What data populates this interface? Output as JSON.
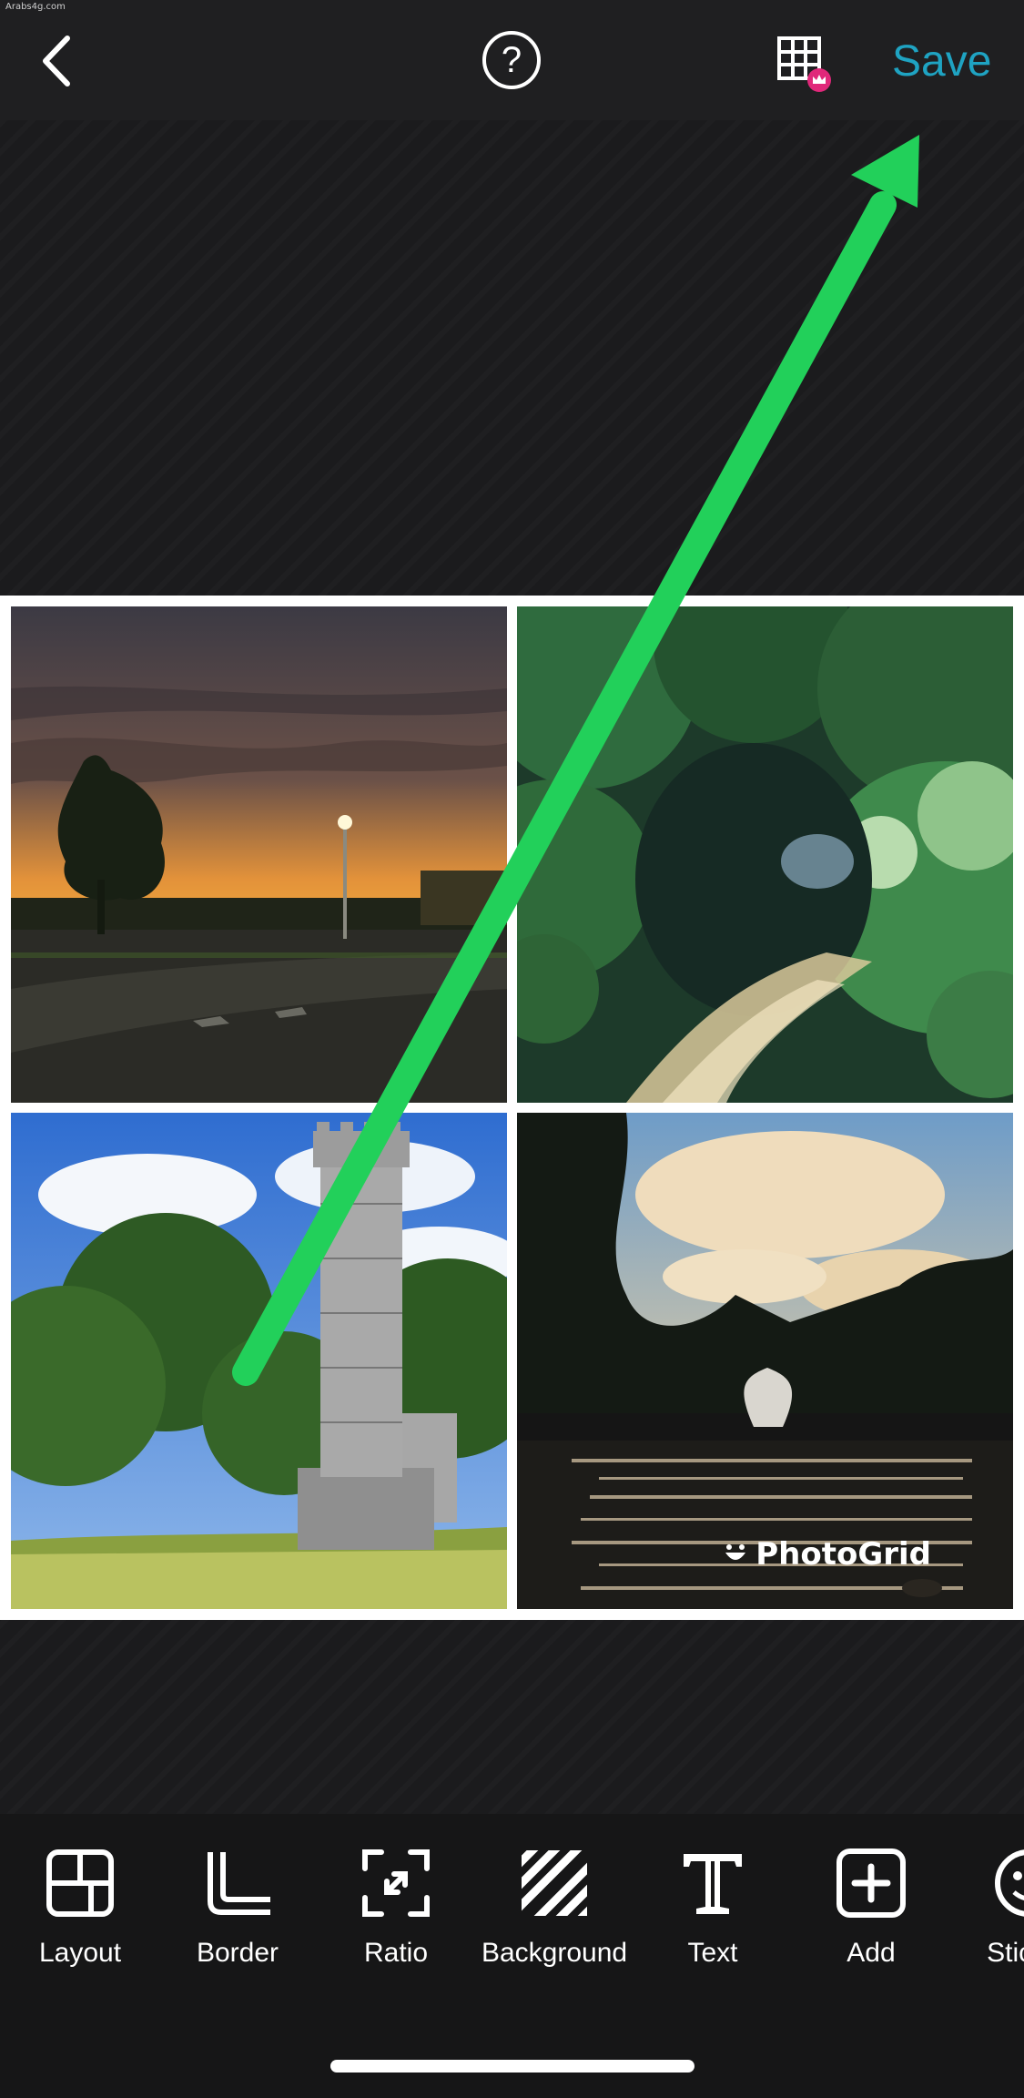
{
  "watermark": "Arabs4g.com",
  "topbar": {
    "back_icon": "chevron-left-icon",
    "help_label": "?",
    "grid_icon": "grid-premium-icon",
    "save_label": "Save",
    "save_color": "#1fa3c2"
  },
  "collage": {
    "photos": [
      {
        "subject": "sunset-road"
      },
      {
        "subject": "forest-stream"
      },
      {
        "subject": "stone-tower"
      },
      {
        "subject": "pond-fountain"
      }
    ],
    "watermark_text": "PhotoGrid"
  },
  "annotation": {
    "arrow_color": "#22d05a",
    "arrow_icon": "arrow-up-right-icon"
  },
  "toolbar": {
    "tools": [
      {
        "label": "Layout",
        "icon": "layout-icon"
      },
      {
        "label": "Border",
        "icon": "border-icon"
      },
      {
        "label": "Ratio",
        "icon": "ratio-icon"
      },
      {
        "label": "Background",
        "icon": "background-icon"
      },
      {
        "label": "Text",
        "icon": "text-icon"
      },
      {
        "label": "Add",
        "icon": "add-icon"
      },
      {
        "label": "Sticker",
        "icon": "sticker-icon"
      }
    ]
  }
}
